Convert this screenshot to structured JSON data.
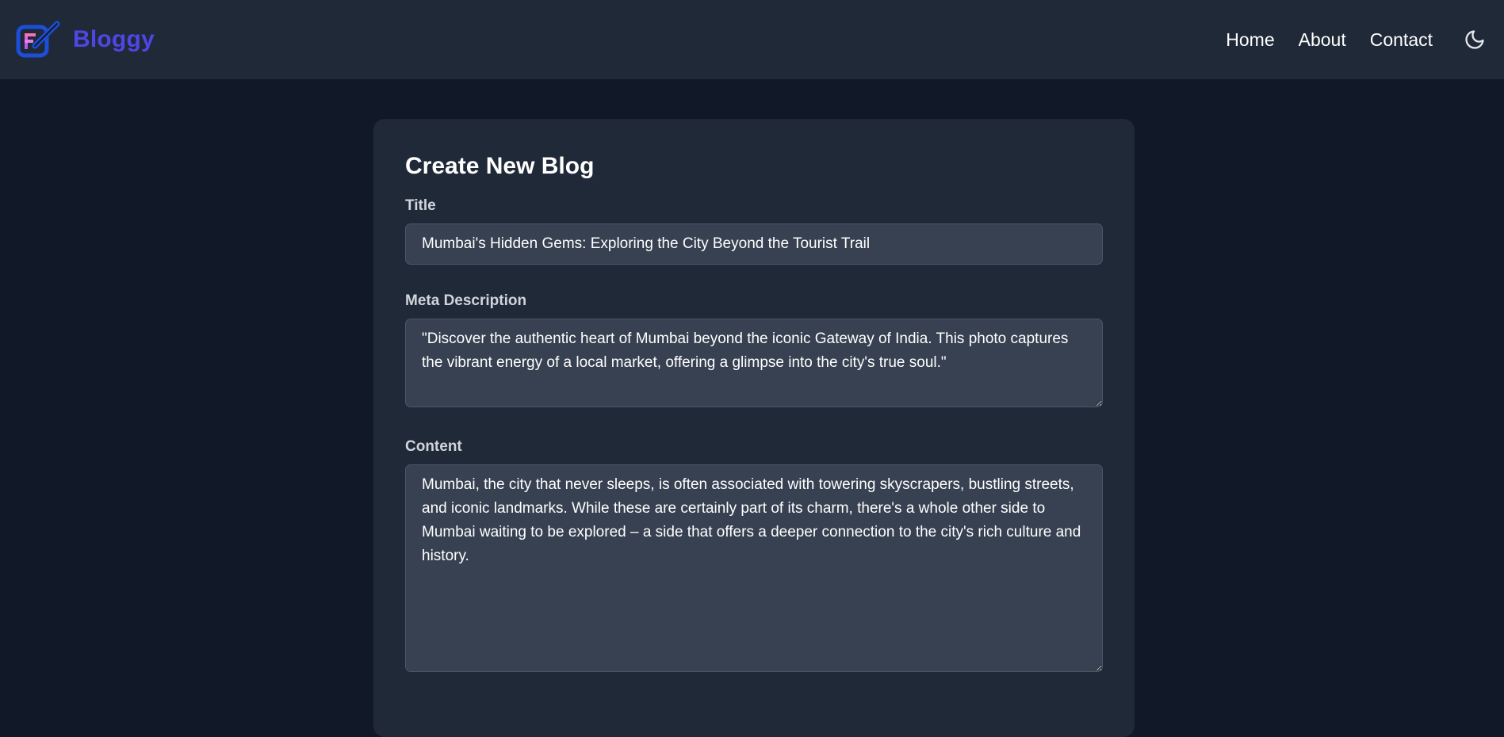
{
  "header": {
    "brand": "Bloggy",
    "nav": [
      {
        "label": "Home"
      },
      {
        "label": "About"
      },
      {
        "label": "Contact"
      }
    ],
    "theme_icon": "moon-icon",
    "colors": {
      "brand": "#4f46e5",
      "header_bg": "#1f2937",
      "page_bg": "#111827"
    }
  },
  "form": {
    "heading": "Create New Blog",
    "title_label": "Title",
    "title_value": "Mumbai's Hidden Gems: Exploring the City Beyond the Tourist Trail",
    "meta_label": "Meta Description",
    "meta_value": "\"Discover the authentic heart of Mumbai beyond the iconic Gateway of India. This photo captures the vibrant energy of a local market, offering a glimpse into the city's true soul.\"",
    "content_label": "Content",
    "content_value": "Mumbai, the city that never sleeps, is often associated with towering skyscrapers, bustling streets, and iconic landmarks. While these are certainly part of its charm, there's a whole other side to Mumbai waiting to be explored – a side that offers a deeper connection to the city's rich culture and history."
  }
}
